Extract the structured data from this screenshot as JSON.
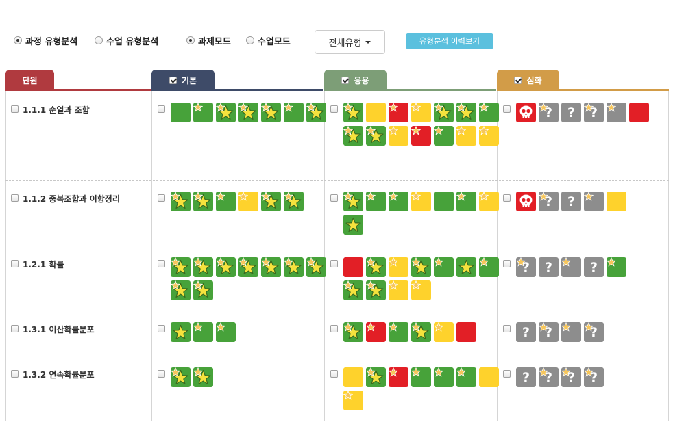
{
  "toolbar": {
    "analysis_options": [
      {
        "label": "과정 유형분석",
        "checked": true
      },
      {
        "label": "수업 유형분석",
        "checked": false
      }
    ],
    "mode_options": [
      {
        "label": "과제모드",
        "checked": true
      },
      {
        "label": "수업모드",
        "checked": false
      }
    ],
    "type_select": "전체유형",
    "history_button": "유형분석 이력보기"
  },
  "columns": [
    {
      "label": "단원",
      "color": "#b03a3f"
    },
    {
      "label": "기본",
      "color": "#3e4b68",
      "checked": true
    },
    {
      "label": "응용",
      "color": "#7d9e77",
      "checked": true
    },
    {
      "label": "심화",
      "color": "#d29c48",
      "checked": true
    }
  ],
  "rows": [
    {
      "unit": "1.1.1 순열과 조합",
      "basic": [
        {
          "c": "green",
          "icon": "none",
          "badge": false
        },
        {
          "c": "green",
          "icon": "none",
          "badge": true
        },
        {
          "c": "green",
          "icon": "star",
          "badge": true
        },
        {
          "c": "green",
          "icon": "star",
          "badge": true
        },
        {
          "c": "green",
          "icon": "star",
          "badge": true
        },
        {
          "c": "green",
          "icon": "none",
          "badge": true
        },
        {
          "c": "green",
          "icon": "star",
          "badge": true
        }
      ],
      "applied": [
        {
          "c": "green",
          "icon": "star",
          "badge": true
        },
        {
          "c": "yellow",
          "icon": "none",
          "badge": false
        },
        {
          "c": "red",
          "icon": "none",
          "badge": true
        },
        {
          "c": "yellow",
          "icon": "none",
          "badge": true
        },
        {
          "c": "green",
          "icon": "star",
          "badge": true
        },
        {
          "c": "green",
          "icon": "star",
          "badge": true
        },
        {
          "c": "green",
          "icon": "none",
          "badge": true
        },
        {
          "c": "green",
          "icon": "star",
          "badge": true
        },
        {
          "c": "green",
          "icon": "star",
          "badge": true
        },
        {
          "c": "yellow",
          "icon": "none",
          "badge": true
        },
        {
          "c": "red",
          "icon": "none",
          "badge": true
        },
        {
          "c": "green",
          "icon": "none",
          "badge": true
        },
        {
          "c": "yellow",
          "icon": "none",
          "badge": true
        },
        {
          "c": "yellow",
          "icon": "none",
          "badge": true
        }
      ],
      "advanced": [
        {
          "c": "red",
          "icon": "skull",
          "badge": false
        },
        {
          "c": "gray",
          "icon": "q",
          "badge": true
        },
        {
          "c": "gray",
          "icon": "q",
          "badge": false
        },
        {
          "c": "gray",
          "icon": "q",
          "badge": true
        },
        {
          "c": "gray",
          "icon": "none",
          "badge": true
        },
        {
          "c": "red",
          "icon": "none",
          "badge": false
        }
      ]
    },
    {
      "unit": "1.1.2 중복조합과 이항정리",
      "basic": [
        {
          "c": "green",
          "icon": "star",
          "badge": true
        },
        {
          "c": "green",
          "icon": "star",
          "badge": true
        },
        {
          "c": "green",
          "icon": "none",
          "badge": true
        },
        {
          "c": "yellow",
          "icon": "none",
          "badge": true
        },
        {
          "c": "green",
          "icon": "star",
          "badge": true
        },
        {
          "c": "green",
          "icon": "star",
          "badge": true
        }
      ],
      "applied": [
        {
          "c": "green",
          "icon": "star",
          "badge": true
        },
        {
          "c": "green",
          "icon": "none",
          "badge": true
        },
        {
          "c": "green",
          "icon": "none",
          "badge": true
        },
        {
          "c": "yellow",
          "icon": "none",
          "badge": true
        },
        {
          "c": "green",
          "icon": "none",
          "badge": false
        },
        {
          "c": "green",
          "icon": "none",
          "badge": true
        },
        {
          "c": "yellow",
          "icon": "none",
          "badge": true
        },
        {
          "c": "green",
          "icon": "star",
          "badge": false
        }
      ],
      "advanced": [
        {
          "c": "red",
          "icon": "skull",
          "badge": false
        },
        {
          "c": "gray",
          "icon": "q",
          "badge": true
        },
        {
          "c": "gray",
          "icon": "q",
          "badge": false
        },
        {
          "c": "gray",
          "icon": "none",
          "badge": true
        },
        {
          "c": "yellow",
          "icon": "none",
          "badge": false
        }
      ]
    },
    {
      "unit": "1.2.1 확률",
      "basic": [
        {
          "c": "green",
          "icon": "star",
          "badge": true
        },
        {
          "c": "green",
          "icon": "star",
          "badge": true
        },
        {
          "c": "green",
          "icon": "star",
          "badge": true
        },
        {
          "c": "green",
          "icon": "star",
          "badge": true
        },
        {
          "c": "green",
          "icon": "star",
          "badge": true
        },
        {
          "c": "green",
          "icon": "star",
          "badge": true
        },
        {
          "c": "green",
          "icon": "star",
          "badge": true
        },
        {
          "c": "green",
          "icon": "star",
          "badge": true
        },
        {
          "c": "green",
          "icon": "star",
          "badge": true
        }
      ],
      "applied": [
        {
          "c": "red",
          "icon": "none",
          "badge": false
        },
        {
          "c": "green",
          "icon": "star",
          "badge": true
        },
        {
          "c": "yellow",
          "icon": "none",
          "badge": true
        },
        {
          "c": "green",
          "icon": "star",
          "badge": true
        },
        {
          "c": "green",
          "icon": "none",
          "badge": true
        },
        {
          "c": "green",
          "icon": "star",
          "badge": false
        },
        {
          "c": "green",
          "icon": "none",
          "badge": true
        },
        {
          "c": "green",
          "icon": "star",
          "badge": true
        },
        {
          "c": "green",
          "icon": "star",
          "badge": true
        },
        {
          "c": "yellow",
          "icon": "none",
          "badge": true
        },
        {
          "c": "yellow",
          "icon": "none",
          "badge": true
        }
      ],
      "advanced": [
        {
          "c": "gray",
          "icon": "q",
          "badge": true
        },
        {
          "c": "gray",
          "icon": "q",
          "badge": false
        },
        {
          "c": "gray",
          "icon": "none",
          "badge": true
        },
        {
          "c": "gray",
          "icon": "q",
          "badge": false
        },
        {
          "c": "green",
          "icon": "none",
          "badge": true
        }
      ]
    },
    {
      "unit": "1.3.1 이산확률분포",
      "basic": [
        {
          "c": "green",
          "icon": "star",
          "badge": false
        },
        {
          "c": "green",
          "icon": "none",
          "badge": true
        },
        {
          "c": "green",
          "icon": "none",
          "badge": true
        }
      ],
      "applied": [
        {
          "c": "green",
          "icon": "star",
          "badge": true
        },
        {
          "c": "red",
          "icon": "none",
          "badge": true
        },
        {
          "c": "green",
          "icon": "none",
          "badge": true
        },
        {
          "c": "green",
          "icon": "star",
          "badge": true
        },
        {
          "c": "yellow",
          "icon": "none",
          "badge": true
        },
        {
          "c": "red",
          "icon": "none",
          "badge": false
        }
      ],
      "advanced": [
        {
          "c": "gray",
          "icon": "q",
          "badge": false
        },
        {
          "c": "gray",
          "icon": "q",
          "badge": true
        },
        {
          "c": "gray",
          "icon": "none",
          "badge": true
        },
        {
          "c": "gray",
          "icon": "q",
          "badge": true
        }
      ]
    },
    {
      "unit": "1.3.2 연속확률분포",
      "basic": [
        {
          "c": "green",
          "icon": "star",
          "badge": true
        },
        {
          "c": "green",
          "icon": "star",
          "badge": true
        }
      ],
      "applied": [
        {
          "c": "yellow",
          "icon": "none",
          "badge": false
        },
        {
          "c": "green",
          "icon": "star",
          "badge": true
        },
        {
          "c": "red",
          "icon": "none",
          "badge": true
        },
        {
          "c": "green",
          "icon": "none",
          "badge": true
        },
        {
          "c": "green",
          "icon": "none",
          "badge": true
        },
        {
          "c": "green",
          "icon": "none",
          "badge": true
        },
        {
          "c": "yellow",
          "icon": "none",
          "badge": false
        },
        {
          "c": "yellow",
          "icon": "none",
          "badge": true
        }
      ],
      "advanced": [
        {
          "c": "gray",
          "icon": "q",
          "badge": false
        },
        {
          "c": "gray",
          "icon": "q",
          "badge": true
        },
        {
          "c": "gray",
          "icon": "q",
          "badge": true
        },
        {
          "c": "gray",
          "icon": "q",
          "badge": true
        }
      ]
    }
  ],
  "tile_colors": {
    "green": "#47a23a",
    "yellow": "#fed22c",
    "red": "#e21f26",
    "gray": "#8d8d8d",
    "star": "#f5e23d",
    "badge_star": "#f6c65b"
  }
}
